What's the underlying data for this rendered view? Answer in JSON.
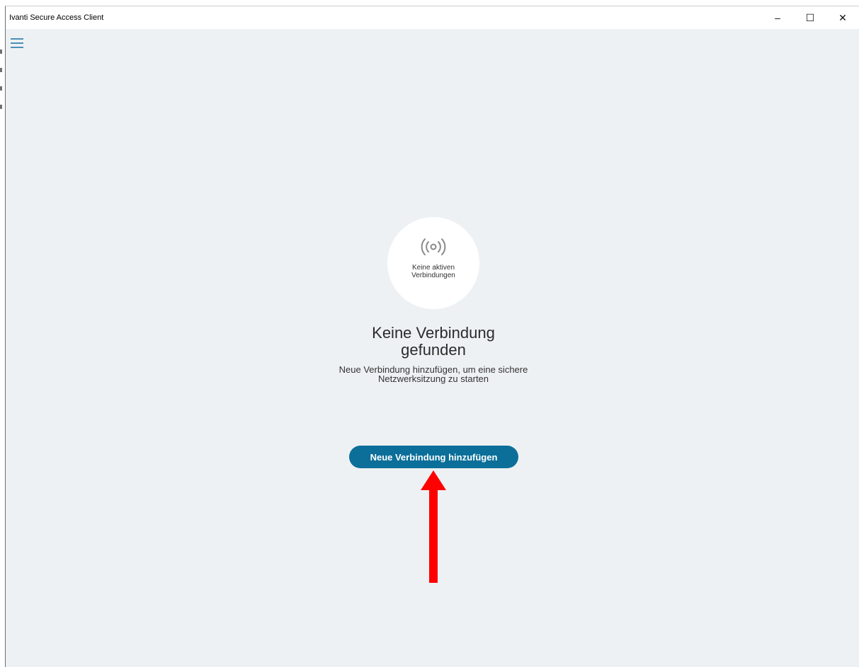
{
  "window": {
    "title": "Ivanti Secure Access Client",
    "minimize_symbol": "–",
    "maximize_symbol": "☐",
    "close_symbol": "✕"
  },
  "menu": {
    "icon": "hamburger-menu-icon"
  },
  "status": {
    "icon": "broadcast-signal-icon",
    "line1": "Keine aktiven",
    "line2": "Verbindungen"
  },
  "empty_state": {
    "heading_line1": "Keine Verbindung",
    "heading_line2": "gefunden",
    "subtext_line1": "Neue Verbindung hinzufügen, um eine sichere",
    "subtext_line2": "Netzwerksitzung zu starten"
  },
  "actions": {
    "add_connection_label": "Neue Verbindung hinzufügen"
  },
  "colors": {
    "accent": "#0b6f99",
    "menu_icon": "#4a90b8",
    "background": "#eef1f4",
    "annotation_arrow": "#ff0000"
  }
}
